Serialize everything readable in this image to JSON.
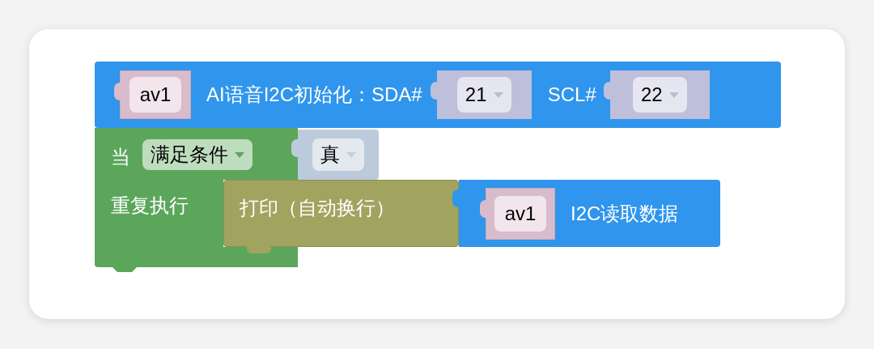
{
  "init_block": {
    "variable": "av1",
    "label": "AI语音I2C初始化：SDA#",
    "sda": {
      "value": "21"
    },
    "scl_label": "SCL#",
    "scl": {
      "value": "22"
    }
  },
  "loop_block": {
    "keyword": "当",
    "mode": "满足条件",
    "condition": "真",
    "body_label": "重复执行"
  },
  "print_block": {
    "label": "打印（自动换行）",
    "argument": {
      "variable": "av1",
      "label": "I2C读取数据"
    }
  }
}
